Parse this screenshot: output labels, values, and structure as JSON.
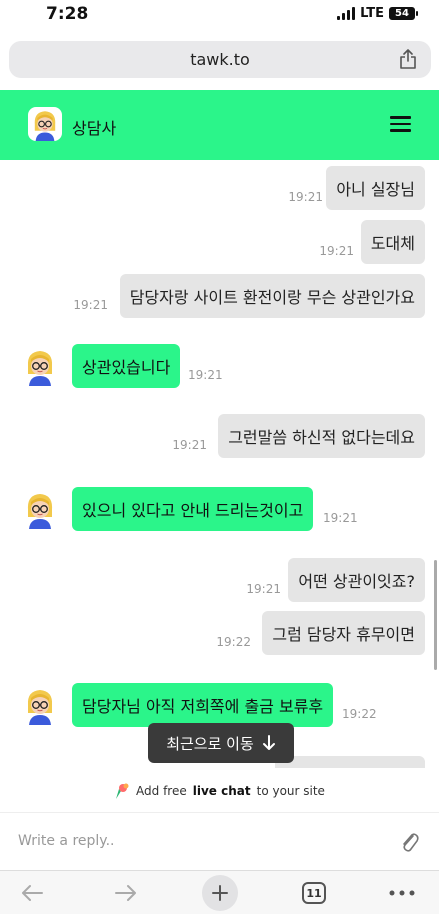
{
  "status_bar": {
    "time": "7:28",
    "network": "LTE",
    "battery": "54"
  },
  "browser": {
    "url": "tawk.to",
    "tab_count": "11"
  },
  "header": {
    "agent_name": "상담사"
  },
  "messages": [
    {
      "dir": "out",
      "text": "아니 실장님",
      "time": "19:21"
    },
    {
      "dir": "out",
      "text": "도대체",
      "time": "19:21"
    },
    {
      "dir": "out",
      "text": "담당자랑 사이트 환전이랑 무슨 상관인가요",
      "time": "19:21"
    },
    {
      "dir": "in",
      "text": "상관있습니다",
      "time": "19:21"
    },
    {
      "dir": "out",
      "text": "그런말씀 하신적 없다는데요",
      "time": "19:21"
    },
    {
      "dir": "in",
      "text": "있으니 있다고 안내 드리는것이고",
      "time": "19:21"
    },
    {
      "dir": "out",
      "text": "어떤 상관이잇죠?",
      "time": "19:21"
    },
    {
      "dir": "out",
      "text": "그럼 담당자 휴무이면",
      "time": "19:22"
    },
    {
      "dir": "in",
      "text": "담당자님 아직 저희쪽에 출금 보류후",
      "time": "19:22"
    }
  ],
  "jump_button": {
    "label": "최근으로 이동"
  },
  "footer": {
    "powered_prefix": "Add free",
    "powered_bold": "live chat",
    "powered_suffix": "to your site",
    "reply_placeholder": "Write a reply.."
  },
  "colors": {
    "accent": "#2bf58a",
    "bubble_out": "#e5e5e5",
    "jump_bg": "#3a3a3a"
  }
}
